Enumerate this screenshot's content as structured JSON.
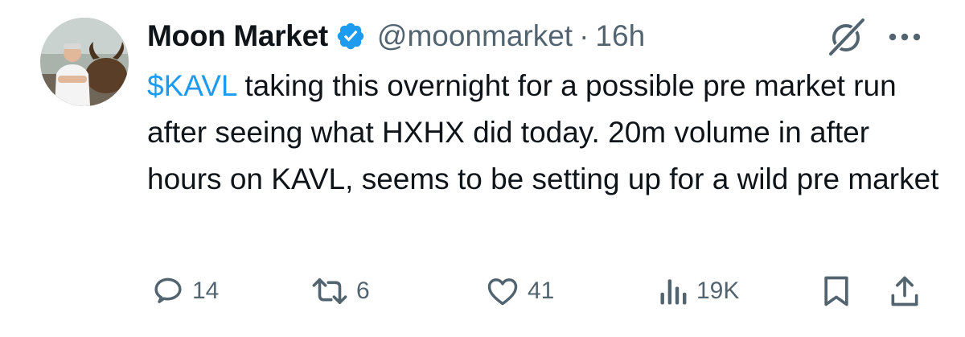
{
  "author": {
    "display_name": "Moon Market",
    "handle": "@moonmarket",
    "separator": "·",
    "timestamp": "16h",
    "avatar_icon": "profile-photo",
    "verified_icon": "verified-badge-icon",
    "verified_color": "#1d9bf0"
  },
  "tweet": {
    "cashtag": "$KAVL",
    "text_after_cashtag": " taking this overnight for a possible pre market run after seeing what HXHX did today. 20m volume in after hours on KAVL, seems to be setting up for a wild pre market"
  },
  "actions": {
    "reply_count": "14",
    "retweet_count": "6",
    "like_count": "41",
    "views_count": "19K"
  },
  "colors": {
    "text": "#0f1419",
    "secondary": "#536471",
    "accent": "#1d9bf0"
  }
}
